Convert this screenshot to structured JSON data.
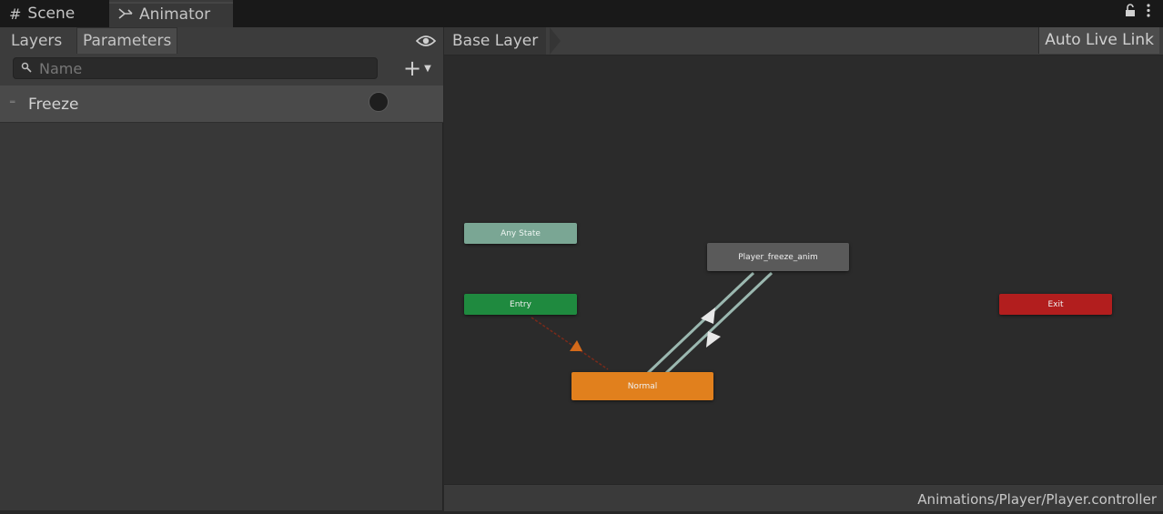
{
  "window_tabs": [
    {
      "label": "Scene",
      "icon": "grid-icon"
    },
    {
      "label": "Animator",
      "icon": "animator-icon"
    }
  ],
  "window_icons": [
    "lock-icon",
    "kebab-menu-icon"
  ],
  "left_panel": {
    "tabs": [
      "Layers",
      "Parameters"
    ],
    "active_tab": "Parameters",
    "search": {
      "placeholder": "Name",
      "value": ""
    },
    "add_button": {
      "label": "+"
    },
    "parameters": [
      {
        "name": "Freeze",
        "type": "trigger",
        "value": "unset"
      }
    ]
  },
  "graph": {
    "breadcrumb": "Base Layer",
    "auto_live_link_label": "Auto Live Link",
    "nodes": {
      "any_state": "Any State",
      "entry": "Entry",
      "exit": "Exit",
      "freeze": "Player_freeze_anim",
      "normal": "Normal"
    },
    "colors": {
      "any_state": "#7aa694",
      "entry": "#1f8a3f",
      "exit": "#b21e1e",
      "state": "#5a5a5a",
      "default_state": "#e1801d",
      "transition": "#9bb8b0",
      "default_transition": "#d46a1a"
    },
    "status_path": "Animations/Player/Player.controller"
  }
}
